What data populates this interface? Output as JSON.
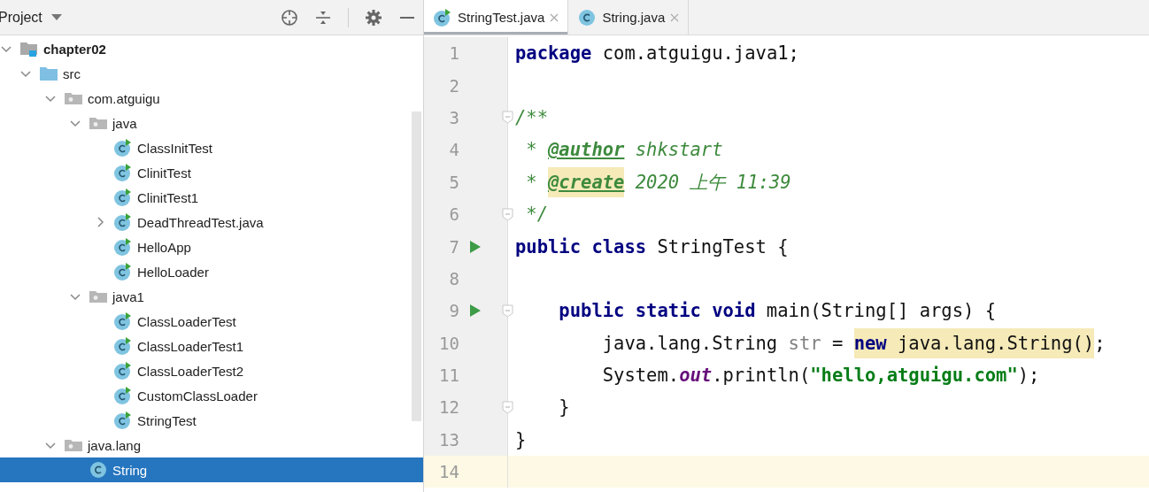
{
  "project_panel": {
    "title": "Project",
    "tree": [
      {
        "label": "chapter02",
        "kind": "module",
        "expanded": true,
        "selected": false,
        "children": [
          {
            "label": "src",
            "kind": "source",
            "expanded": true,
            "selected": false,
            "children": [
              {
                "label": "com.atguigu",
                "kind": "package",
                "expanded": true,
                "selected": false,
                "children": [
                  {
                    "label": "java",
                    "kind": "package",
                    "expanded": true,
                    "selected": false,
                    "children": [
                      {
                        "label": "ClassInitTest",
                        "kind": "runnable",
                        "selected": false
                      },
                      {
                        "label": "ClinitTest",
                        "kind": "runnable",
                        "selected": false
                      },
                      {
                        "label": "ClinitTest1",
                        "kind": "runnable",
                        "selected": false
                      },
                      {
                        "label": "DeadThreadTest.java",
                        "kind": "runnable",
                        "expanded": false,
                        "selected": false
                      },
                      {
                        "label": "HelloApp",
                        "kind": "runnable",
                        "selected": false
                      },
                      {
                        "label": "HelloLoader",
                        "kind": "runnable",
                        "selected": false
                      }
                    ]
                  },
                  {
                    "label": "java1",
                    "kind": "package",
                    "expanded": true,
                    "selected": false,
                    "children": [
                      {
                        "label": "ClassLoaderTest",
                        "kind": "runnable",
                        "selected": false
                      },
                      {
                        "label": "ClassLoaderTest1",
                        "kind": "runnable",
                        "selected": false
                      },
                      {
                        "label": "ClassLoaderTest2",
                        "kind": "runnable",
                        "selected": false
                      },
                      {
                        "label": "CustomClassLoader",
                        "kind": "runnable",
                        "selected": false
                      },
                      {
                        "label": "StringTest",
                        "kind": "runnable",
                        "selected": false
                      }
                    ]
                  }
                ]
              },
              {
                "label": "java.lang",
                "kind": "package",
                "expanded": true,
                "selected": false,
                "children": [
                  {
                    "label": "String",
                    "kind": "class",
                    "selected": true
                  }
                ]
              }
            ]
          }
        ]
      }
    ]
  },
  "editor": {
    "tabs": [
      {
        "label": "StringTest.java",
        "kind": "runnable",
        "selected": true
      },
      {
        "label": "String.java",
        "kind": "class",
        "selected": false
      }
    ],
    "lines": [
      {
        "number": "1",
        "tokens": [
          {
            "kind": "keyword",
            "text": "package"
          },
          {
            "kind": "plain",
            "text": " com.atguigu.java1;"
          }
        ]
      },
      {
        "number": "2"
      },
      {
        "number": "3",
        "fold": true,
        "tokens": [
          {
            "kind": "comment",
            "text": "/**"
          }
        ]
      },
      {
        "number": "4",
        "tokens": [
          {
            "kind": "comment",
            "text": " * "
          },
          {
            "kind": "doctag",
            "text": "@author"
          },
          {
            "kind": "comment",
            "text": " shkstart"
          }
        ]
      },
      {
        "number": "5",
        "tokens": [
          {
            "kind": "comment",
            "text": " * "
          },
          {
            "kind": "doctag",
            "text": "@create",
            "highlighted": true
          },
          {
            "kind": "comment",
            "text": " 2020 上午 11:39"
          }
        ]
      },
      {
        "number": "6",
        "fold": true,
        "tokens": [
          {
            "kind": "comment",
            "text": " */"
          }
        ]
      },
      {
        "number": "7",
        "run": true,
        "tokens": [
          {
            "kind": "keyword",
            "text": "public class"
          },
          {
            "kind": "plain",
            "text": " StringTest {"
          }
        ]
      },
      {
        "number": "8"
      },
      {
        "number": "9",
        "run": true,
        "fold": true,
        "tokens": [
          {
            "kind": "keyword",
            "text": "    public static void"
          },
          {
            "kind": "plain",
            "text": " main(String[] args) {"
          }
        ]
      },
      {
        "number": "10",
        "tokens": [
          {
            "kind": "plain",
            "text": "        java.lang.String "
          },
          {
            "kind": "unused",
            "text": "str"
          },
          {
            "kind": "plain",
            "text": " = "
          },
          {
            "kind": "keyword",
            "text": "new",
            "highlighted": true
          },
          {
            "kind": "plain",
            "text": " java.lang.String()",
            "highlighted": true
          },
          {
            "kind": "plain",
            "text": ";"
          }
        ]
      },
      {
        "number": "11",
        "tokens": [
          {
            "kind": "plain",
            "text": "        System."
          },
          {
            "kind": "static",
            "text": "out"
          },
          {
            "kind": "plain",
            "text": ".println("
          },
          {
            "kind": "string",
            "text": "\"hello,atguigu.com\""
          },
          {
            "kind": "plain",
            "text": ");"
          }
        ]
      },
      {
        "number": "12",
        "fold": true,
        "tokens": [
          {
            "kind": "plain",
            "text": "    }"
          }
        ]
      },
      {
        "number": "13",
        "tokens": [
          {
            "kind": "plain",
            "text": "}"
          }
        ]
      },
      {
        "number": "14",
        "current": true
      }
    ]
  }
}
